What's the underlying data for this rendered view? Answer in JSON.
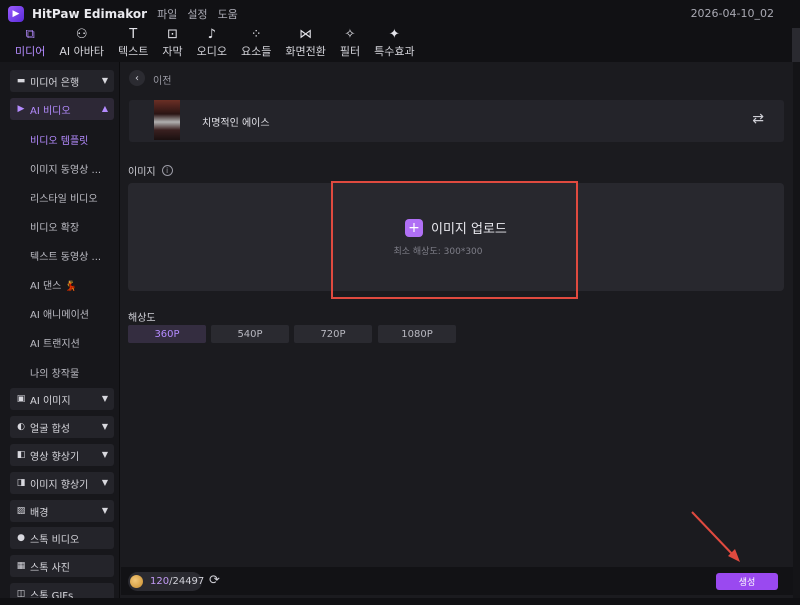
{
  "app": {
    "logo_text": "▶",
    "title": "HitPaw Edimakor",
    "menu": [
      "파일",
      "설정",
      "도움"
    ],
    "project_name": "2026-04-10_02"
  },
  "toolbar": [
    {
      "icon": "media-icon",
      "glyph": "⧉",
      "label": "미디어",
      "active": true
    },
    {
      "icon": "ai-avatar-icon",
      "glyph": "⚇",
      "label": "AI 아바타",
      "active": false
    },
    {
      "icon": "text-icon",
      "glyph": "T",
      "label": "텍스트",
      "active": false
    },
    {
      "icon": "subtitle-icon",
      "glyph": "⊡",
      "label": "자막",
      "active": false
    },
    {
      "icon": "audio-icon",
      "glyph": "♪",
      "label": "오디오",
      "active": false
    },
    {
      "icon": "elements-icon",
      "glyph": "⁘",
      "label": "요소들",
      "active": false
    },
    {
      "icon": "transition-icon",
      "glyph": "⋈",
      "label": "화면전환",
      "active": false
    },
    {
      "icon": "filter-icon",
      "glyph": "✧",
      "label": "필터",
      "active": false
    },
    {
      "icon": "effects-icon",
      "glyph": "✦",
      "label": "특수효과",
      "active": false
    }
  ],
  "sidebar": {
    "groups": [
      {
        "label": "미디어 은행",
        "icon": "folder-icon",
        "glyph": "▬",
        "arrow": "▼",
        "open": false
      },
      {
        "label": "AI 비디오",
        "icon": "ai-video-icon",
        "glyph": "▶",
        "arrow": "▲",
        "open": true
      },
      {
        "label": "AI  이미지",
        "icon": "ai-image-icon",
        "glyph": "▣",
        "arrow": "▼",
        "open": false
      },
      {
        "label": "얼굴 합성",
        "icon": "face-swap-icon",
        "glyph": "◐",
        "arrow": "▼",
        "open": false
      },
      {
        "label": "영상 향상기",
        "icon": "video-enhance-icon",
        "glyph": "◧",
        "arrow": "▼",
        "open": false
      },
      {
        "label": "이미지 향상기",
        "icon": "image-enhance-icon",
        "glyph": "◨",
        "arrow": "▼",
        "open": false
      },
      {
        "label": "배경",
        "icon": "background-icon",
        "glyph": "▨",
        "arrow": "▼",
        "open": false
      },
      {
        "label": "스톡 비디오",
        "icon": "stock-video-icon",
        "glyph": "●",
        "arrow": "",
        "open": false
      },
      {
        "label": "스톡 사진",
        "icon": "stock-photo-icon",
        "glyph": "▦",
        "arrow": "",
        "open": false
      },
      {
        "label": "스톡 GIFs",
        "icon": "stock-gif-icon",
        "glyph": "◫",
        "arrow": "",
        "open": false
      }
    ],
    "ai_video_items": [
      {
        "label": "비디오 템플릿",
        "active": true
      },
      {
        "label": "이미지 동영상 ...",
        "active": false
      },
      {
        "label": "리스타일 비디오",
        "active": false
      },
      {
        "label": "비디오 확장",
        "active": false
      },
      {
        "label": "텍스트 동영상 ...",
        "active": false
      },
      {
        "label": "AI 댄스 💃",
        "active": false
      },
      {
        "label": "AI 애니메이션",
        "active": false
      },
      {
        "label": "AI 트랜지션",
        "active": false
      },
      {
        "label": "나의 창작물",
        "active": false
      }
    ]
  },
  "main": {
    "back_label": "이전",
    "template_name": "치명적인 에이스",
    "image_section_label": "이미지",
    "upload_label": "이미지 업로드",
    "min_resolution": "최소 해상도: 300*300",
    "resolution_label": "해상도",
    "resolutions": [
      {
        "label": "360P",
        "active": true
      },
      {
        "label": "540P",
        "active": false
      },
      {
        "label": "720P",
        "active": false
      },
      {
        "label": "1080P",
        "active": false
      }
    ],
    "credits_used": "120",
    "credits_total": "/24497",
    "generate_label": "생성"
  },
  "colors": {
    "accent": "#b48bff",
    "generate": "#9a49f0",
    "highlight": "#e04a3f"
  }
}
